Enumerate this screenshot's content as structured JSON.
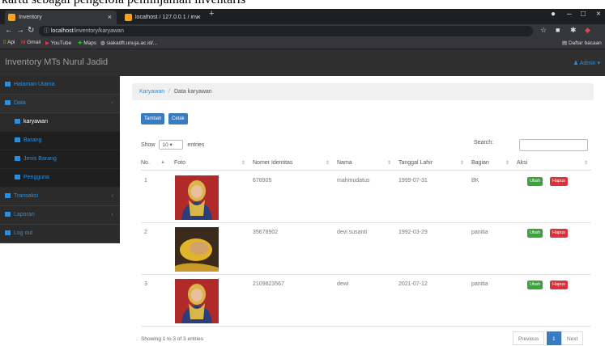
{
  "caption": "kartu sebagai pengelola peminjaman inventaris",
  "browser": {
    "tabs": [
      {
        "title": "Inventory",
        "active": true
      },
      {
        "title": "localhost / 127.0.0.1 / inventory / ",
        "active": false
      }
    ],
    "new_tab": "+",
    "url_host": "localhost",
    "url_path": "/inventory/karyawan",
    "bookmarks": [
      "Apl",
      "Gmail",
      "YouTube",
      "Maps",
      "siakadft.unuja.ac.id/..."
    ],
    "reading_list": "Daftar bacaan"
  },
  "app": {
    "title": "Inventory MTs Nurul Jadid",
    "user": "Admin"
  },
  "sidebar": {
    "items": [
      {
        "label": "Halaman Utama"
      },
      {
        "label": "Data"
      },
      {
        "label": "karyawan"
      },
      {
        "label": "Barang"
      },
      {
        "label": "Jenis Barang"
      },
      {
        "label": "Pengguna"
      },
      {
        "label": "Transaksi"
      },
      {
        "label": "Laporan"
      },
      {
        "label": "Log out"
      }
    ]
  },
  "breadcrumb": {
    "parent": "Karyawan",
    "sep": "/",
    "current": "Data karyawan"
  },
  "toolbar": {
    "add": "Tambah",
    "print": "Cetak"
  },
  "length": {
    "show": "Show",
    "value": "10",
    "entries": "entries"
  },
  "search_label": "Search:",
  "table": {
    "headers": [
      "No.",
      "Foto",
      "Nomer Identitas",
      "Nama",
      "Tanggal Lahir",
      "Bagian",
      "Aksi"
    ],
    "rows": [
      {
        "no": "1",
        "id": "678905",
        "nama": "mahmudatus",
        "tgl": "1999-07-31",
        "bagian": "BK",
        "edit": "Ubah",
        "delete": "Hapus"
      },
      {
        "no": "2",
        "id": "35678902",
        "nama": "devi susanti",
        "tgl": "1992-03-29",
        "bagian": "panitia",
        "edit": "Ubah",
        "delete": "Hapus"
      },
      {
        "no": "3",
        "id": "2109823567",
        "nama": "dewi",
        "tgl": "2021-07-12",
        "bagian": "panitia",
        "edit": "Ubah",
        "delete": "Hapus"
      }
    ]
  },
  "footer": {
    "info": "Showing 1 to 3 of 3 entries",
    "prev": "Previous",
    "page": "1",
    "next": "Next"
  },
  "colors": {
    "accent": "#3a7bc0",
    "sidebar_bg": "#2b2b2b",
    "link": "#2d8fdb",
    "edit": "#3aa43a",
    "delete": "#d9343a"
  }
}
